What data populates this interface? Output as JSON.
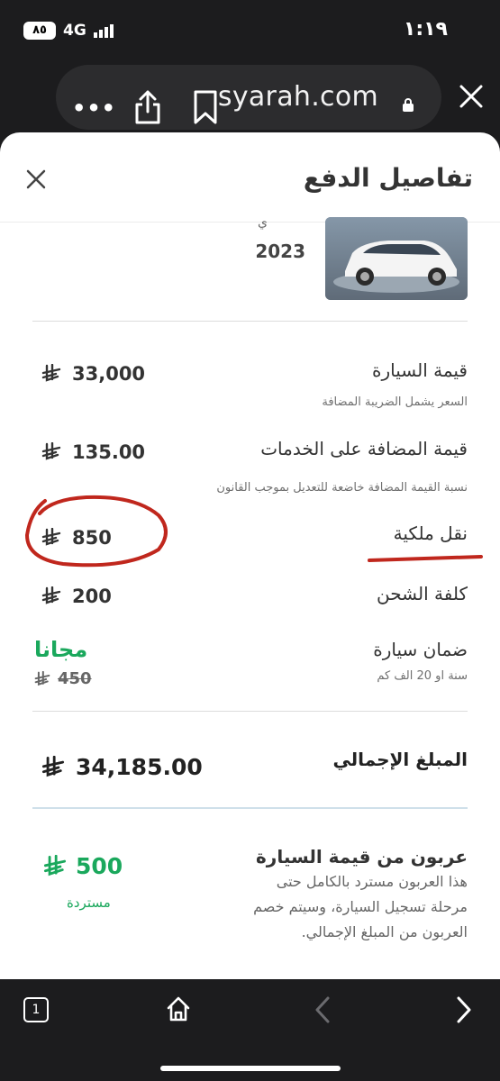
{
  "status_bar": {
    "time": "١:١٩",
    "battery": "٨٥",
    "network": "4G"
  },
  "browser": {
    "url": "syarah.com"
  },
  "sheet": {
    "title": "تفاصيل الدفع",
    "car": {
      "year": "2023",
      "fragment": "ي"
    },
    "rows": [
      {
        "label": "قيمة السيارة",
        "note": "السعر يشمل الضريبة المضافة",
        "value": "33,000"
      },
      {
        "label": "قيمة المضافة على الخدمات",
        "note": "نسبة القيمة المضافة خاضعة للتعديل بموجب القانون",
        "value": "135.00"
      },
      {
        "label": "نقل ملكية",
        "value": "850"
      },
      {
        "label": "كلفة الشحن",
        "value": "200"
      },
      {
        "label": "ضمان سيارة",
        "note": "سنة او 20 الف كم",
        "value": "مجانا",
        "old_value": "450"
      }
    ],
    "total": {
      "label": "المبلغ الإجمالي",
      "value": "34,185.00"
    },
    "deposit": {
      "title": "عربون من قيمة السيارة",
      "description": "هذا العربون مسترد بالكامل حتى مرحلة تسجيل السيارة، وسيتم خصم العربون من المبلغ الإجمالي.",
      "value": "500",
      "status": "مستردة"
    }
  },
  "bottom_bar": {
    "tab_count": "1"
  },
  "colors": {
    "green": "#1aa85c",
    "annotation_red": "#c0271d"
  }
}
